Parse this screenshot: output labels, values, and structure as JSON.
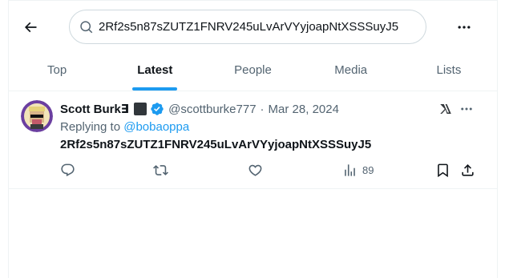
{
  "search": {
    "query": "2Rf2s5n87sZUTZ1FNRV245uLvArVYyjoapNtXSSSuyJ5"
  },
  "tabs": [
    {
      "label": "Top",
      "active": false
    },
    {
      "label": "Latest",
      "active": true
    },
    {
      "label": "People",
      "active": false
    },
    {
      "label": "Media",
      "active": false
    },
    {
      "label": "Lists",
      "active": false
    }
  ],
  "tweet": {
    "display_name": "Scott Burk∃",
    "handle": "@scottburke777",
    "separator": "·",
    "date": "Mar 28, 2024",
    "replying_prefix": "Replying to",
    "replying_handle": "@bobaoppa",
    "text": "2Rf2s5n87sZUTZ1FNRV245uLvArVYyjoapNtXSSSuyJ5",
    "views": "89"
  },
  "colors": {
    "accent": "#1d9bf0",
    "text": "#0f1419",
    "secondary": "#536471",
    "border": "#eff3f4"
  },
  "icons": [
    "back-arrow-icon",
    "search-icon",
    "more-icon",
    "verified-badge-icon",
    "grok-icon",
    "reply-icon",
    "retweet-icon",
    "like-icon",
    "views-icon",
    "bookmark-icon",
    "share-icon"
  ]
}
